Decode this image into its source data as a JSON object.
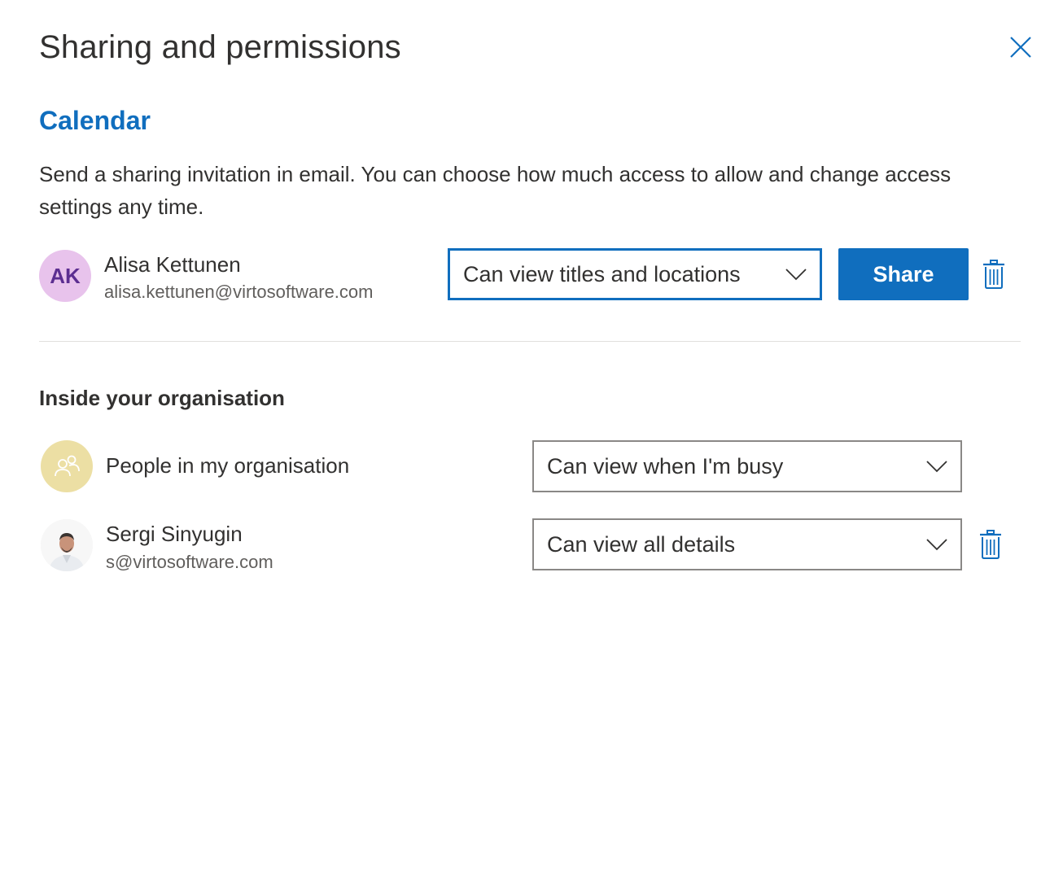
{
  "dialog": {
    "title": "Sharing and permissions",
    "close_icon": "close-icon"
  },
  "calendar": {
    "heading": "Calendar",
    "description": "Send a sharing invitation in email. You can choose how much access to allow and change access settings any time."
  },
  "invite": {
    "initials": "AK",
    "name": "Alisa Kettunen",
    "email": "alisa.kettunen@virtosoftware.com",
    "permission": "Can view titles and locations",
    "share_label": "Share"
  },
  "organisation": {
    "heading": "Inside your organisation",
    "members": [
      {
        "name": "People in my organisation",
        "permission": "Can view when I'm busy",
        "avatar_icon": "people-group-icon"
      },
      {
        "name": "Sergi Sinyugin",
        "email": "s@virtosoftware.com",
        "permission": "Can view all details",
        "avatar_icon": "user-photo"
      }
    ]
  },
  "colors": {
    "accent": "#106ebe",
    "ak_avatar_bg": "#e8c3ec",
    "ak_avatar_text": "#5c2e91",
    "org_avatar_bg": "#ecdfa4",
    "text": "#323130",
    "muted": "#605e5c",
    "divider": "#e1dfdd"
  }
}
